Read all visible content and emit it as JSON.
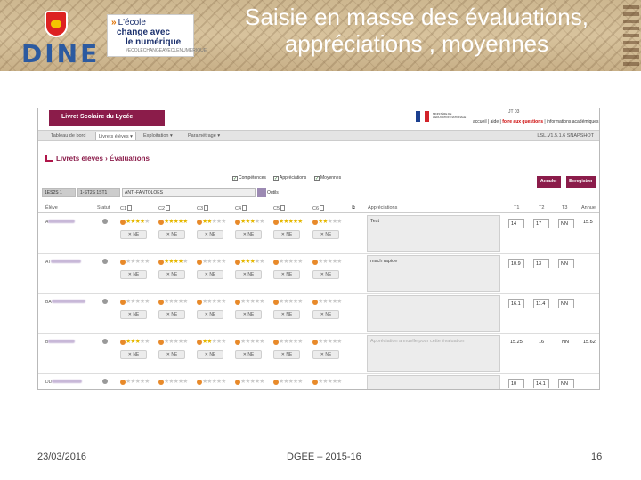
{
  "slide": {
    "title_line1": "Saisie en masse des évaluations,",
    "title_line2": "appréciations , moyennes",
    "footer_date": "23/03/2016",
    "footer_center": "DGEE – 2015-16",
    "footer_page": "16"
  },
  "logos": {
    "dine_word": "DINE",
    "ecole_line1": "L'école",
    "ecole_line2": "change avec",
    "ecole_line3": "le numérique",
    "ecole_line4": "#ECOLECHANGEAVECLENUMERIQUE"
  },
  "app": {
    "app_title": "Livret Scolaire du Lycée",
    "ministry_small": "MINISTÈRE DE L'ÉDUCATION NATIONALE",
    "user_label": "JT 03",
    "links": [
      "accueil",
      "aide",
      "foire aux questions",
      "informations académiques",
      "quitter"
    ],
    "menu": [
      "Tableau de bord",
      "Livrets élèves ▾",
      "Exploitation ▾",
      "Paramétrage ▾"
    ],
    "menu_right": "LSL.V1.5.1.6 SNAPSHOT",
    "section_title": "Livrets élèves › Évaluations",
    "checkboxes": [
      "Compétences",
      "Appréciations",
      "Moyennes"
    ],
    "btn_cancel": "Annuler",
    "btn_save": "Enregistrer",
    "filter1": "1ES2S 1",
    "filter2": "1-ST2S 1ST1",
    "filter3": "ANTI-FANTOLOES",
    "filter_tools": "Outils"
  },
  "columns": {
    "eleve": "Élève",
    "statut": "Statut",
    "c1": "C1",
    "c2": "C2",
    "c3": "C3",
    "c4": "C4",
    "c5": "C5",
    "c6": "C6",
    "appreciations": "Appréciations",
    "t1": "T1",
    "t2": "T2",
    "t3": "T3",
    "annuel": "Annuel"
  },
  "rows": [
    {
      "name": "A",
      "stars": [
        4,
        5,
        2,
        3,
        5,
        2
      ],
      "ne": [
        "NE",
        "NE",
        "NE",
        "NE",
        "NE",
        "NE"
      ],
      "appreciation": "Test",
      "t1": "14",
      "t2": "17",
      "t3": "NN",
      "annuel": "15.5"
    },
    {
      "name": "AT",
      "stars": [
        0,
        4,
        0,
        3,
        0,
        0
      ],
      "ne": [
        "NE",
        "NE",
        "NE",
        "NE",
        "NE",
        "NE"
      ],
      "appreciation": "mach rapide",
      "t1": "10.9",
      "t2": "13",
      "t3": "NN",
      "annuel": ""
    },
    {
      "name": "BA",
      "stars": [
        0,
        0,
        0,
        0,
        0,
        0
      ],
      "ne": [
        "NE",
        "NE",
        "NE",
        "NE",
        "NE",
        "NE"
      ],
      "appreciation": "",
      "t1": "16.1",
      "t2": "11.4",
      "t3": "NN",
      "annuel": ""
    },
    {
      "name": "B",
      "stars": [
        3,
        0,
        2,
        0,
        0,
        0
      ],
      "ne": [
        "NE",
        "NE",
        "NE",
        "NE",
        "NE",
        "NE"
      ],
      "appreciation": "Appréciation annuelle pour cette évaluation",
      "t1": "15.25",
      "t2": "16",
      "t3": "NN",
      "annuel": "15.62"
    },
    {
      "name": "DD",
      "stars": [
        0,
        0,
        0,
        0,
        0,
        0
      ],
      "ne": [
        "NE",
        "NE",
        "NE",
        "NE",
        "NE",
        "NE"
      ],
      "appreciation": "",
      "t1": "10",
      "t2": "14.1",
      "t3": "NN",
      "annuel": ""
    }
  ]
}
